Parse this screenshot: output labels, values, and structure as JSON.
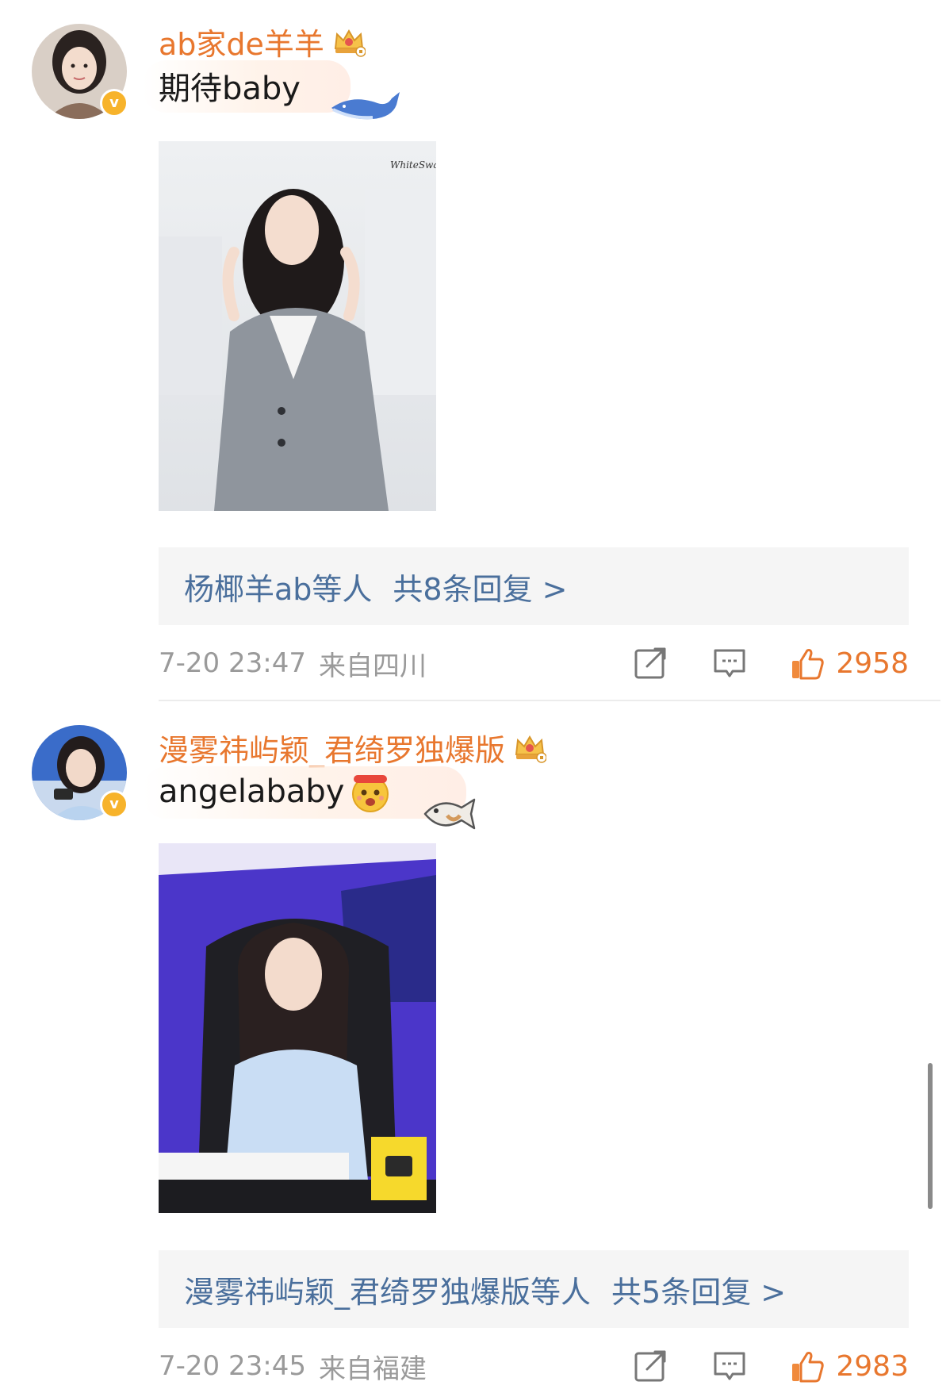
{
  "comments": [
    {
      "username": "ab家de羊羊",
      "text": "期待baby",
      "avatar_icon": "avatar-woman-icon",
      "badge": "v",
      "crown_icon": "crown-icon",
      "sticker_icon": "whale-icon",
      "photo_caption": "WhiteSwan",
      "reply_names": "杨椰羊ab等人",
      "reply_count": "共8条回复 >",
      "time": "7-20 23:47",
      "location": "来自四川",
      "likes": "2958"
    },
    {
      "username": "漫雾祎屿颖_君绮罗独爆版",
      "text": "angelababy",
      "avatar_icon": "avatar-woman-icon",
      "badge": "v",
      "crown_icon": "crown-icon",
      "sticker_icon": "fish-icon",
      "emoji_icon": "cheer-face-emoji",
      "reply_names": "漫雾祎屿颖_君绮罗独爆版等人",
      "reply_count": "共5条回复 >",
      "time": "7-20 23:45",
      "location": "来自福建",
      "likes": "2983"
    }
  ],
  "colors": {
    "username": "#e8772e",
    "like_count": "#e8772e",
    "reply_link": "#4a6f9c",
    "meta": "#9a9a9a",
    "reply_box_bg": "#f5f5f5",
    "verified_badge": "#f7b32b"
  }
}
